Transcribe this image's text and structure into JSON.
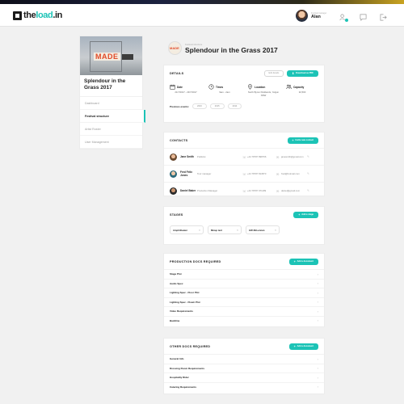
{
  "colors": {
    "accent": "#1cc3b6",
    "text": "#222222",
    "background": "#f1f1f1"
  },
  "topbar": {
    "logo": {
      "part1": "the",
      "part2": "load",
      "part3": ".in"
    },
    "user": {
      "role": "Festival manager",
      "name": "Alan"
    },
    "icons": [
      "user-add-icon",
      "chat-icon",
      "logout-icon"
    ]
  },
  "sidebar": {
    "image_text": "MADE",
    "title": "Splendour in the Grass 2017",
    "items": [
      {
        "label": "Dashboard",
        "active": false
      },
      {
        "label": "Festival structure",
        "active": true
      },
      {
        "label": "Artist Roster",
        "active": false
      },
      {
        "label": "User Management",
        "active": false
      }
    ]
  },
  "festival": {
    "subtitle": "Festival structure",
    "title": "Splendour in the Grass 2017"
  },
  "details": {
    "title": "DETAILS",
    "edit_label": "Edit details",
    "download_label": "Download as PDF",
    "fields": [
      {
        "label": "Date",
        "value": "21/7/2017 - 23/7/2017",
        "icon": "calendar-icon"
      },
      {
        "label": "Times",
        "value": "9am - 2am",
        "icon": "clock-icon"
      },
      {
        "label": "Location",
        "value": "North Byron Parklands, Yelgun NSW",
        "icon": "location-icon"
      },
      {
        "label": "Capacity",
        "value": "32,500",
        "icon": "people-icon"
      }
    ],
    "previous_label": "Previous events:",
    "previous_events": [
      "2016",
      "2015",
      "2014"
    ]
  },
  "contacts": {
    "title": "CONTACTS",
    "add_label": "Invite new contact",
    "rows": [
      {
        "name": "Jane Smith",
        "role": "Publicist",
        "phone": "+44 78787 898766",
        "email": "janesmith@gmail.com"
      },
      {
        "name": "Fred Felix Jones",
        "role": "Tour manager",
        "phone": "+44 78787 813873",
        "email": "fred@hotmail.com"
      },
      {
        "name": "Daniel Baker",
        "role": "Production Manager",
        "phone": "+44 78787 971189",
        "email": "daniel@gmail.com"
      }
    ]
  },
  "stages": {
    "title": "STAGES",
    "add_label": "Add a stage",
    "items": [
      "Amphitheater",
      "Mixup tent",
      "GW McLennan"
    ]
  },
  "production_docs": {
    "title": "PRODUCTION DOCS REQUIRED",
    "add_label": "Add a document",
    "items": [
      "Stage Plot",
      "Audio Spec",
      "Lighting Spec - Floor Plot",
      "Lighting Spec - Flown Plot",
      "Video Requirements",
      "Backline"
    ]
  },
  "other_docs": {
    "title": "OTHER DOCS REQUIRED",
    "add_label": "Add a document",
    "items": [
      "General Info",
      "Dressing Room Requirements",
      "Hospitality Rider",
      "Catering Requirements"
    ]
  }
}
